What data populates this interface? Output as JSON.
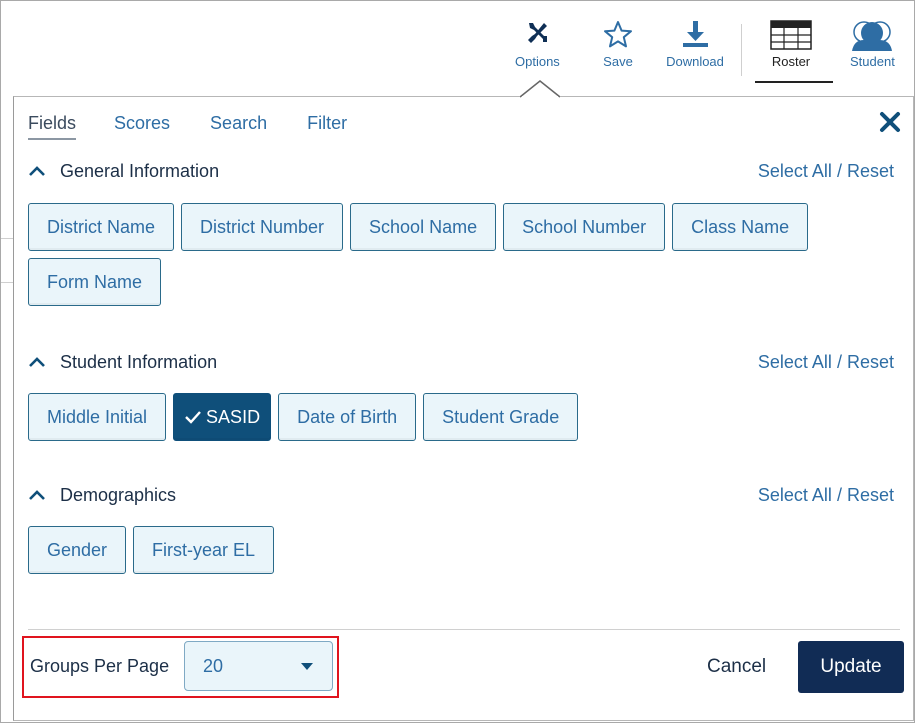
{
  "toolbar": {
    "options_label": "Options",
    "save_label": "Save",
    "download_label": "Download",
    "roster_label": "Roster",
    "student_label": "Student",
    "accent": "#2e6da4"
  },
  "tabs": [
    {
      "label": "Fields",
      "active": true
    },
    {
      "label": "Scores"
    },
    {
      "label": "Search"
    },
    {
      "label": "Filter"
    }
  ],
  "select_all_label": "Select All",
  "reset_label": "Reset",
  "sections": [
    {
      "title": "General Information",
      "fields": [
        "District Name",
        "District Number",
        "School Name",
        "School Number",
        "Class Name",
        "Form Name"
      ]
    },
    {
      "title": "Student Information",
      "fields": [
        "Middle Initial",
        "SASID",
        "Date of Birth",
        "Student Grade"
      ],
      "selected": "SASID"
    },
    {
      "title": "Demographics",
      "fields": [
        "Gender",
        "First-year EL"
      ]
    }
  ],
  "footer": {
    "groups_label": "Groups Per Page",
    "groups_value": "20",
    "cancel_label": "Cancel",
    "update_label": "Update",
    "highlight_color": "#e0141e",
    "update_color": "#112c55"
  }
}
